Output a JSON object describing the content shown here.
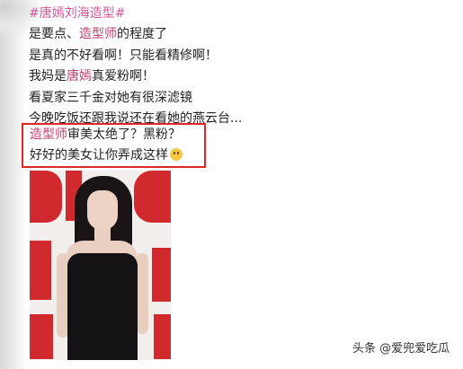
{
  "post": {
    "hashtag": "#唐嫣刘海造型#",
    "lines": [
      {
        "segments": [
          {
            "text": "是要点、",
            "style": "plain"
          },
          {
            "text": "造型师",
            "style": "hl"
          },
          {
            "text": "的程度了",
            "style": "plain"
          }
        ]
      },
      {
        "segments": [
          {
            "text": "是真的不好看啊！只能看精修啊！",
            "style": "plain"
          }
        ]
      },
      {
        "segments": [
          {
            "text": "我妈是",
            "style": "plain"
          },
          {
            "text": "唐嫣",
            "style": "hl"
          },
          {
            "text": "真爱粉啊！",
            "style": "plain"
          }
        ]
      },
      {
        "segments": [
          {
            "text": "看夏家三千金对她有很深滤镜",
            "style": "plain"
          }
        ]
      },
      {
        "segments": [
          {
            "text": "今晚吃饭还跟我说还在看她的燕云台...",
            "style": "plain"
          }
        ]
      }
    ],
    "highlighted_lines": [
      {
        "segments": [
          {
            "text": "造型师",
            "style": "hl"
          },
          {
            "text": "审美太绝了？黑粉？",
            "style": "plain"
          }
        ]
      },
      {
        "segments": [
          {
            "text": "好好的美女让你弄成这样",
            "style": "plain"
          }
        ],
        "emoji": "face-with-hand-over-mouth-emoji"
      }
    ]
  },
  "watermark": {
    "text": "头条 @爱兜爱吃瓜"
  },
  "colors": {
    "hashtag": "#d4569a",
    "highlight": "#c23b6e",
    "box_border": "#e0262a",
    "backdrop_red": "#d02a2f"
  }
}
